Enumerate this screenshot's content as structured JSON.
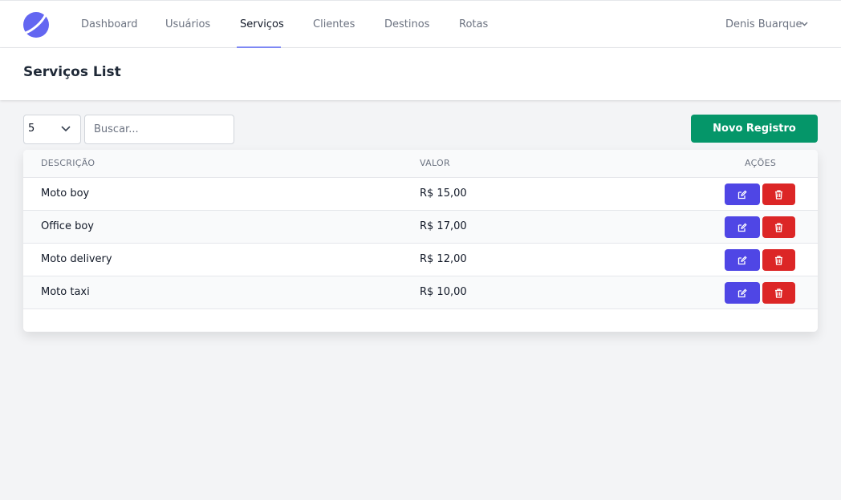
{
  "colors": {
    "brand": "#6366f1",
    "primary": "#4f46e5",
    "success": "#059669",
    "danger": "#dc2626"
  },
  "nav": {
    "logo_icon": "brand-logo-icon",
    "links": [
      {
        "label": "Dashboard",
        "active": false
      },
      {
        "label": "Usuários",
        "active": false
      },
      {
        "label": "Serviços",
        "active": true
      },
      {
        "label": "Clientes",
        "active": false
      },
      {
        "label": "Destinos",
        "active": false
      },
      {
        "label": "Rotas",
        "active": false
      }
    ],
    "user": {
      "name": "Denis Buarque",
      "icon": "chevron-down-icon"
    }
  },
  "page": {
    "title": "Serviços List"
  },
  "toolbar": {
    "per_page": "5",
    "search_placeholder": "Buscar...",
    "search_value": "",
    "new_button": "Novo Registro"
  },
  "table": {
    "columns": [
      "DESCRIÇÃO",
      "VALOR",
      "AÇÕES"
    ],
    "rows": [
      {
        "descricao": "Moto boy",
        "valor": "R$ 15,00"
      },
      {
        "descricao": "Office boy",
        "valor": "R$ 17,00"
      },
      {
        "descricao": "Moto delivery",
        "valor": "R$ 12,00"
      },
      {
        "descricao": "Moto taxi",
        "valor": "R$ 10,00"
      }
    ],
    "action_icons": [
      "edit-icon",
      "trash-icon"
    ]
  }
}
